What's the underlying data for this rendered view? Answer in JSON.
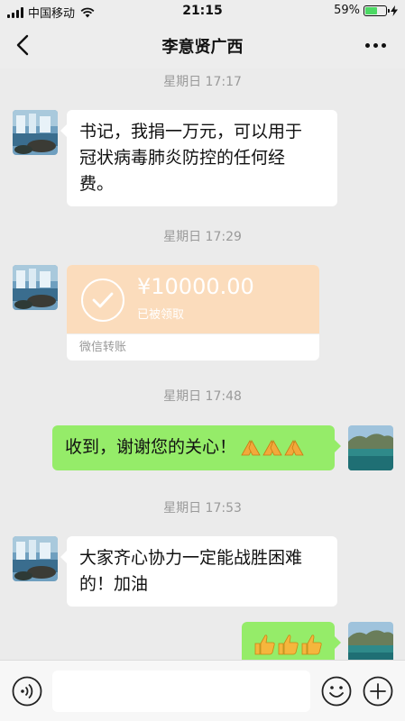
{
  "status_bar": {
    "carrier": "中国移动",
    "time": "21:15",
    "battery": "59%",
    "battery_level": 0.59
  },
  "nav": {
    "title": "李意贤广西",
    "back_icon": "chevron-left-icon",
    "more_icon": "more-dots-icon"
  },
  "messages": [
    {
      "type": "timestamp",
      "text": "星期日 17:17"
    },
    {
      "type": "text",
      "direction": "in",
      "lines": [
        "书记，我捐一万元，可以用于",
        "冠状病毒肺炎防控的任何经",
        "费。"
      ]
    },
    {
      "type": "timestamp",
      "text": "星期日 17:29"
    },
    {
      "type": "transfer",
      "direction": "in",
      "amount": "¥10000.00",
      "status": "已被领取",
      "footer": "微信转账"
    },
    {
      "type": "timestamp",
      "text": "星期日 17:48"
    },
    {
      "type": "text",
      "direction": "out",
      "text": "收到，谢谢您的关心！",
      "emoji": "praying-hands-icon",
      "emoji_count": 3
    },
    {
      "type": "timestamp",
      "text": "星期日 17:53"
    },
    {
      "type": "text",
      "direction": "in",
      "lines": [
        "大家齐心协力一定能战胜困难",
        "的！加油"
      ]
    },
    {
      "type": "emoji",
      "direction": "out",
      "emoji": "thumbs-up-icon",
      "emoji_count": 3
    }
  ],
  "input_bar": {
    "voice_icon": "voice-icon",
    "input_value": "",
    "emoji_icon": "emoji-smile-icon",
    "plus_icon": "plus-icon"
  },
  "colors": {
    "background": "#ebebeb",
    "bubble_out": "#95ec69",
    "bubble_in": "#ffffff",
    "transfer": "#fbdcbc"
  }
}
